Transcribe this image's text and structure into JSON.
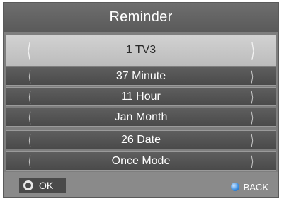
{
  "title": "Reminder",
  "rows": [
    {
      "value": "1  TV3",
      "selected": true
    },
    {
      "value": "37 Minute"
    },
    {
      "value": "11 Hour"
    },
    {
      "value": "Jan Month"
    },
    {
      "value": "26 Date"
    },
    {
      "value": "Once Mode"
    }
  ],
  "arrows": {
    "left": "⟨",
    "right": "⟩"
  },
  "footer": {
    "ok_label": "OK",
    "back_label": "BACK"
  },
  "colors": {
    "panel": "#7e7e7e",
    "selected_row": "#c8c8c8",
    "row": "#555555",
    "back_dot": "#3e8fe0"
  },
  "icons": {
    "ok": "ok-circle-icon",
    "back": "blue-dot-icon"
  }
}
